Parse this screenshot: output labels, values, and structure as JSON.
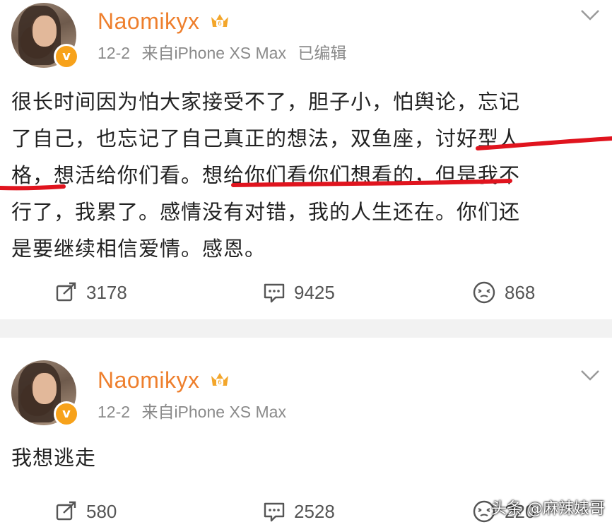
{
  "posts": [
    {
      "username": "Naomikyx",
      "date": "12-2",
      "source": "来自iPhone XS Max",
      "edited": "已编辑",
      "content_lines": [
        "很长时间因为怕大家接受不了，胆子小，怕舆论，忘记",
        "了自己，也忘记了自己真正的想法，双鱼座，讨好型人",
        "格，想活给你们看。想给你们看你们想看的，但是我不",
        "行了，我累了。感情没有对错，我的人生还在。你们还",
        "是要继续相信爱情。感恩。"
      ],
      "repost_count": "3178",
      "comment_count": "9425",
      "like_count": "868"
    },
    {
      "username": "Naomikyx",
      "date": "12-2",
      "source": "来自iPhone XS Max",
      "content_lines": [
        "我想逃走"
      ],
      "repost_count": "580",
      "comment_count": "2528",
      "like_count": "220"
    }
  ],
  "watermark": "头条 @麻辣婊哥",
  "colors": {
    "username": "#ee7f2d",
    "verified_badge": "#f7a21b",
    "markup_red": "#e0141e",
    "meta": "#8a8a8a"
  },
  "icons": [
    "repost-icon",
    "comment-icon",
    "like-icon",
    "chevron-down-icon",
    "crown-icon",
    "verified-badge-icon"
  ]
}
